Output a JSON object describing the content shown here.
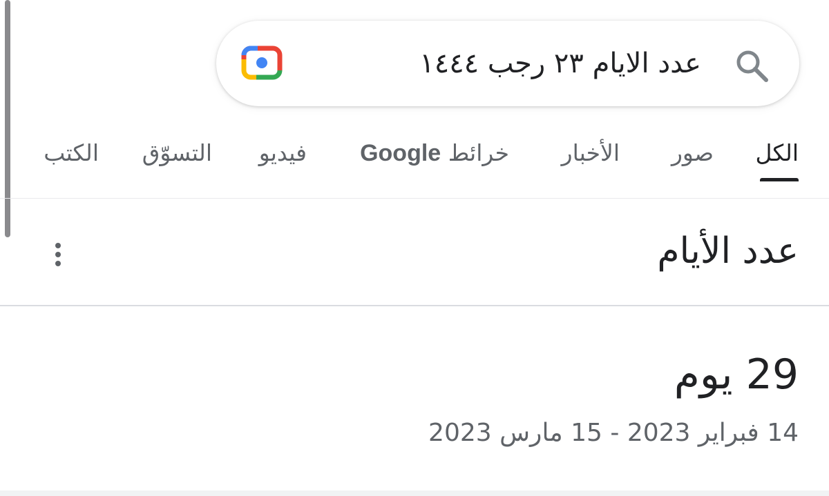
{
  "search": {
    "query": "عدد الايام ٢٣ رجب ١٤٤٤"
  },
  "tabs": [
    {
      "label": "الكل",
      "active": true
    },
    {
      "label": "صور",
      "active": false
    },
    {
      "label": "الأخبار",
      "active": false
    },
    {
      "label": "خرائط",
      "brand": "Google",
      "active": false
    },
    {
      "label": "فيديو",
      "active": false
    },
    {
      "label": "التسوّق",
      "active": false
    },
    {
      "label": "الكتب",
      "active": false
    }
  ],
  "card": {
    "title": "عدد الأيام",
    "result_number": "29",
    "result_unit": "يوم",
    "date_range": "14 فبراير 2023 - 15 مارس 2023"
  },
  "colors": {
    "lens_blue": "#4285f4",
    "lens_red": "#ea4335",
    "lens_yellow": "#fbbc04",
    "lens_green": "#34a853",
    "text_primary": "#202124",
    "text_secondary": "#5f6368"
  },
  "icons": {
    "lens": "google-lens-icon",
    "search": "search-icon",
    "more": "more-vertical-icon"
  }
}
